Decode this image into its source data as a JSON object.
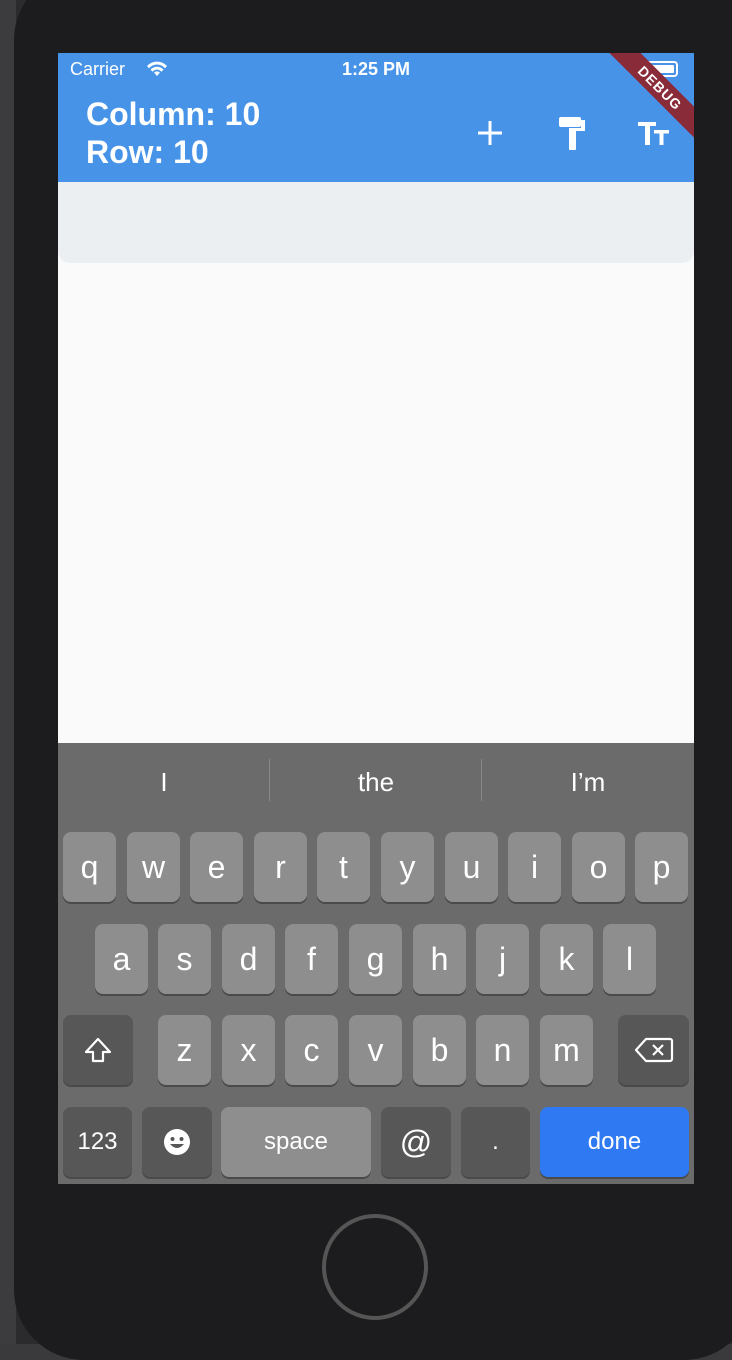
{
  "app": {
    "title_line1": "Column: 10",
    "title_line2": "Row: 10",
    "debug_label": "DEBUG"
  },
  "status_bar": {
    "carrier": "Carrier",
    "time": "1:25 PM"
  },
  "actions": [
    {
      "icon": "add-icon"
    },
    {
      "icon": "paint-roller-icon"
    },
    {
      "icon": "text-size-icon"
    }
  ],
  "keyboard": {
    "suggestions": [
      "I",
      "the",
      "I’m"
    ],
    "row1": [
      "q",
      "w",
      "e",
      "r",
      "t",
      "y",
      "u",
      "i",
      "o",
      "p"
    ],
    "row2": [
      "a",
      "s",
      "d",
      "f",
      "g",
      "h",
      "j",
      "k",
      "l"
    ],
    "row3": [
      "z",
      "x",
      "c",
      "v",
      "b",
      "n",
      "m"
    ],
    "key_123": "123",
    "key_space": "space",
    "key_at": "@",
    "key_dot": ".",
    "key_done": "done"
  },
  "colors": {
    "appbar": "#4693e8",
    "done": "#2f7af2",
    "debug_ribbon": "#8a2b3a"
  }
}
